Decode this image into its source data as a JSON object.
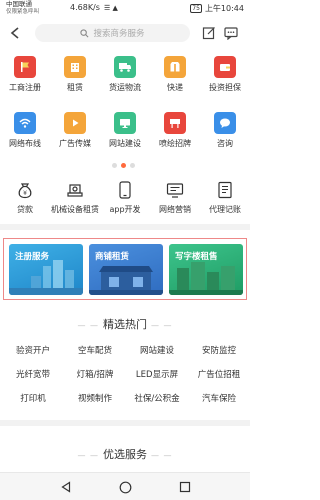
{
  "status_bar": {
    "carrier1": "中国联通",
    "carrier2": "仅限紧急呼叫",
    "speed": "4.68K/s",
    "signal_icons": "☰ ▲",
    "battery": "75",
    "time": "上午10:44"
  },
  "search": {
    "placeholder": "搜索商务服务"
  },
  "grid": [
    {
      "label": "工商注册",
      "icon": "flag-icon",
      "color": "#e8463c"
    },
    {
      "label": "租赁",
      "icon": "building-icon",
      "color": "#f4a53a"
    },
    {
      "label": "货运物流",
      "icon": "truck-icon",
      "color": "#3bbf8a"
    },
    {
      "label": "快递",
      "icon": "package-icon",
      "color": "#f4a53a"
    },
    {
      "label": "投资担保",
      "icon": "wallet-icon",
      "color": "#e8463c"
    },
    {
      "label": "网络布线",
      "icon": "wifi-icon",
      "color": "#3a8fe8"
    },
    {
      "label": "广告传媒",
      "icon": "play-icon",
      "color": "#f4a53a"
    },
    {
      "label": "网站建设",
      "icon": "monitor-icon",
      "color": "#3bbf8a"
    },
    {
      "label": "喷绘招牌",
      "icon": "signboard-icon",
      "color": "#e8463c"
    },
    {
      "label": "咨询",
      "icon": "chat-icon",
      "color": "#3a8fe8"
    }
  ],
  "services": [
    {
      "label": "贷款",
      "icon": "money-bag-icon"
    },
    {
      "label": "机械设备租赁",
      "icon": "machine-icon"
    },
    {
      "label": "app开发",
      "icon": "phone-icon"
    },
    {
      "label": "网络营销",
      "icon": "screen-icon"
    },
    {
      "label": "代理记账",
      "icon": "ledger-icon"
    }
  ],
  "banners": [
    {
      "label": "注册服务",
      "color": "#2a9ad6"
    },
    {
      "label": "商铺租赁",
      "color": "#3a7fd0"
    },
    {
      "label": "写字楼租售",
      "color": "#2fb57d"
    }
  ],
  "hot": {
    "title": "精选热门",
    "items": [
      "验资开户",
      "空车配货",
      "网站建设",
      "安防监控",
      "光纤宽带",
      "灯箱/招牌",
      "LED显示屏",
      "广告位招租",
      "打印机",
      "视频制作",
      "社保/公积金",
      "汽车保险"
    ]
  },
  "preferred": {
    "title": "优选服务"
  }
}
